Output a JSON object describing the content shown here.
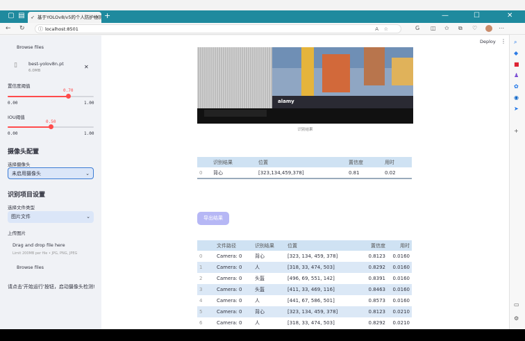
{
  "browser": {
    "tab_title": "基于YOLOv8/v5的个人防护检测",
    "url": "localhost:8501"
  },
  "sidebar": {
    "browse_files_top": "Browse files",
    "uploaded_file": {
      "name": "best-yolov8n.pt",
      "size": "6.0MB"
    },
    "confidence": {
      "label": "置信度阈值",
      "value": "0.70",
      "min": "0.00",
      "max": "1.00",
      "fraction": 0.7
    },
    "iou": {
      "label": "IOU阈值",
      "value": "0.50",
      "min": "0.00",
      "max": "1.00",
      "fraction": 0.5
    },
    "camera_section": "摄像头配置",
    "camera_label": "选择摄像头",
    "camera_value": "未启用摄像头",
    "project_section": "识别项目设置",
    "filetype_label": "选择文件类型",
    "filetype_value": "图片文件",
    "upload_label": "上传图片",
    "drag_drop": "Drag and drop file here",
    "limit": "Limit 200MB per file • JPG, PNG, JPEG",
    "browse_files": "Browse files",
    "hint": "请点击'开始运行'按钮，启动摄像头检测!"
  },
  "main": {
    "deploy": "Deploy",
    "image_caption": "识别结果",
    "watermark": "alamy",
    "result_table": {
      "headers": [
        "识别结果",
        "位置",
        "置信度",
        "用时"
      ],
      "rows": [
        {
          "idx": "0",
          "cells": [
            "背心",
            "[323,134,459,378]",
            "0.81",
            "0.02"
          ]
        }
      ]
    },
    "export_button": "导出结果",
    "log_table": {
      "headers": [
        "文件路径",
        "识别结果",
        "位置",
        "置信度",
        "用时"
      ],
      "rows": [
        {
          "idx": "0",
          "cells": [
            "Camera: 0",
            "背心",
            "[323, 134, 459, 378]",
            "0.8123",
            "0.0160"
          ]
        },
        {
          "idx": "1",
          "cells": [
            "Camera: 0",
            "人",
            "[318, 33, 474, 503]",
            "0.8292",
            "0.0160"
          ]
        },
        {
          "idx": "2",
          "cells": [
            "Camera: 0",
            "头盔",
            "[496, 69, 551, 142]",
            "0.8391",
            "0.0160"
          ]
        },
        {
          "idx": "3",
          "cells": [
            "Camera: 0",
            "头盔",
            "[411, 33, 469, 116]",
            "0.8463",
            "0.0160"
          ]
        },
        {
          "idx": "4",
          "cells": [
            "Camera: 0",
            "人",
            "[441, 67, 586, 501]",
            "0.8573",
            "0.0160"
          ]
        },
        {
          "idx": "5",
          "cells": [
            "Camera: 0",
            "背心",
            "[323, 134, 459, 378]",
            "0.8123",
            "0.0210"
          ]
        },
        {
          "idx": "6",
          "cells": [
            "Camera: 0",
            "人",
            "[318, 33, 474, 503]",
            "0.8292",
            "0.0210"
          ]
        }
      ]
    }
  },
  "colors": {
    "accent": "#ff4b4b",
    "tabbar": "#1f8a9e",
    "table_header": "#cfe2f3",
    "export_button": "#b6b7f5"
  }
}
